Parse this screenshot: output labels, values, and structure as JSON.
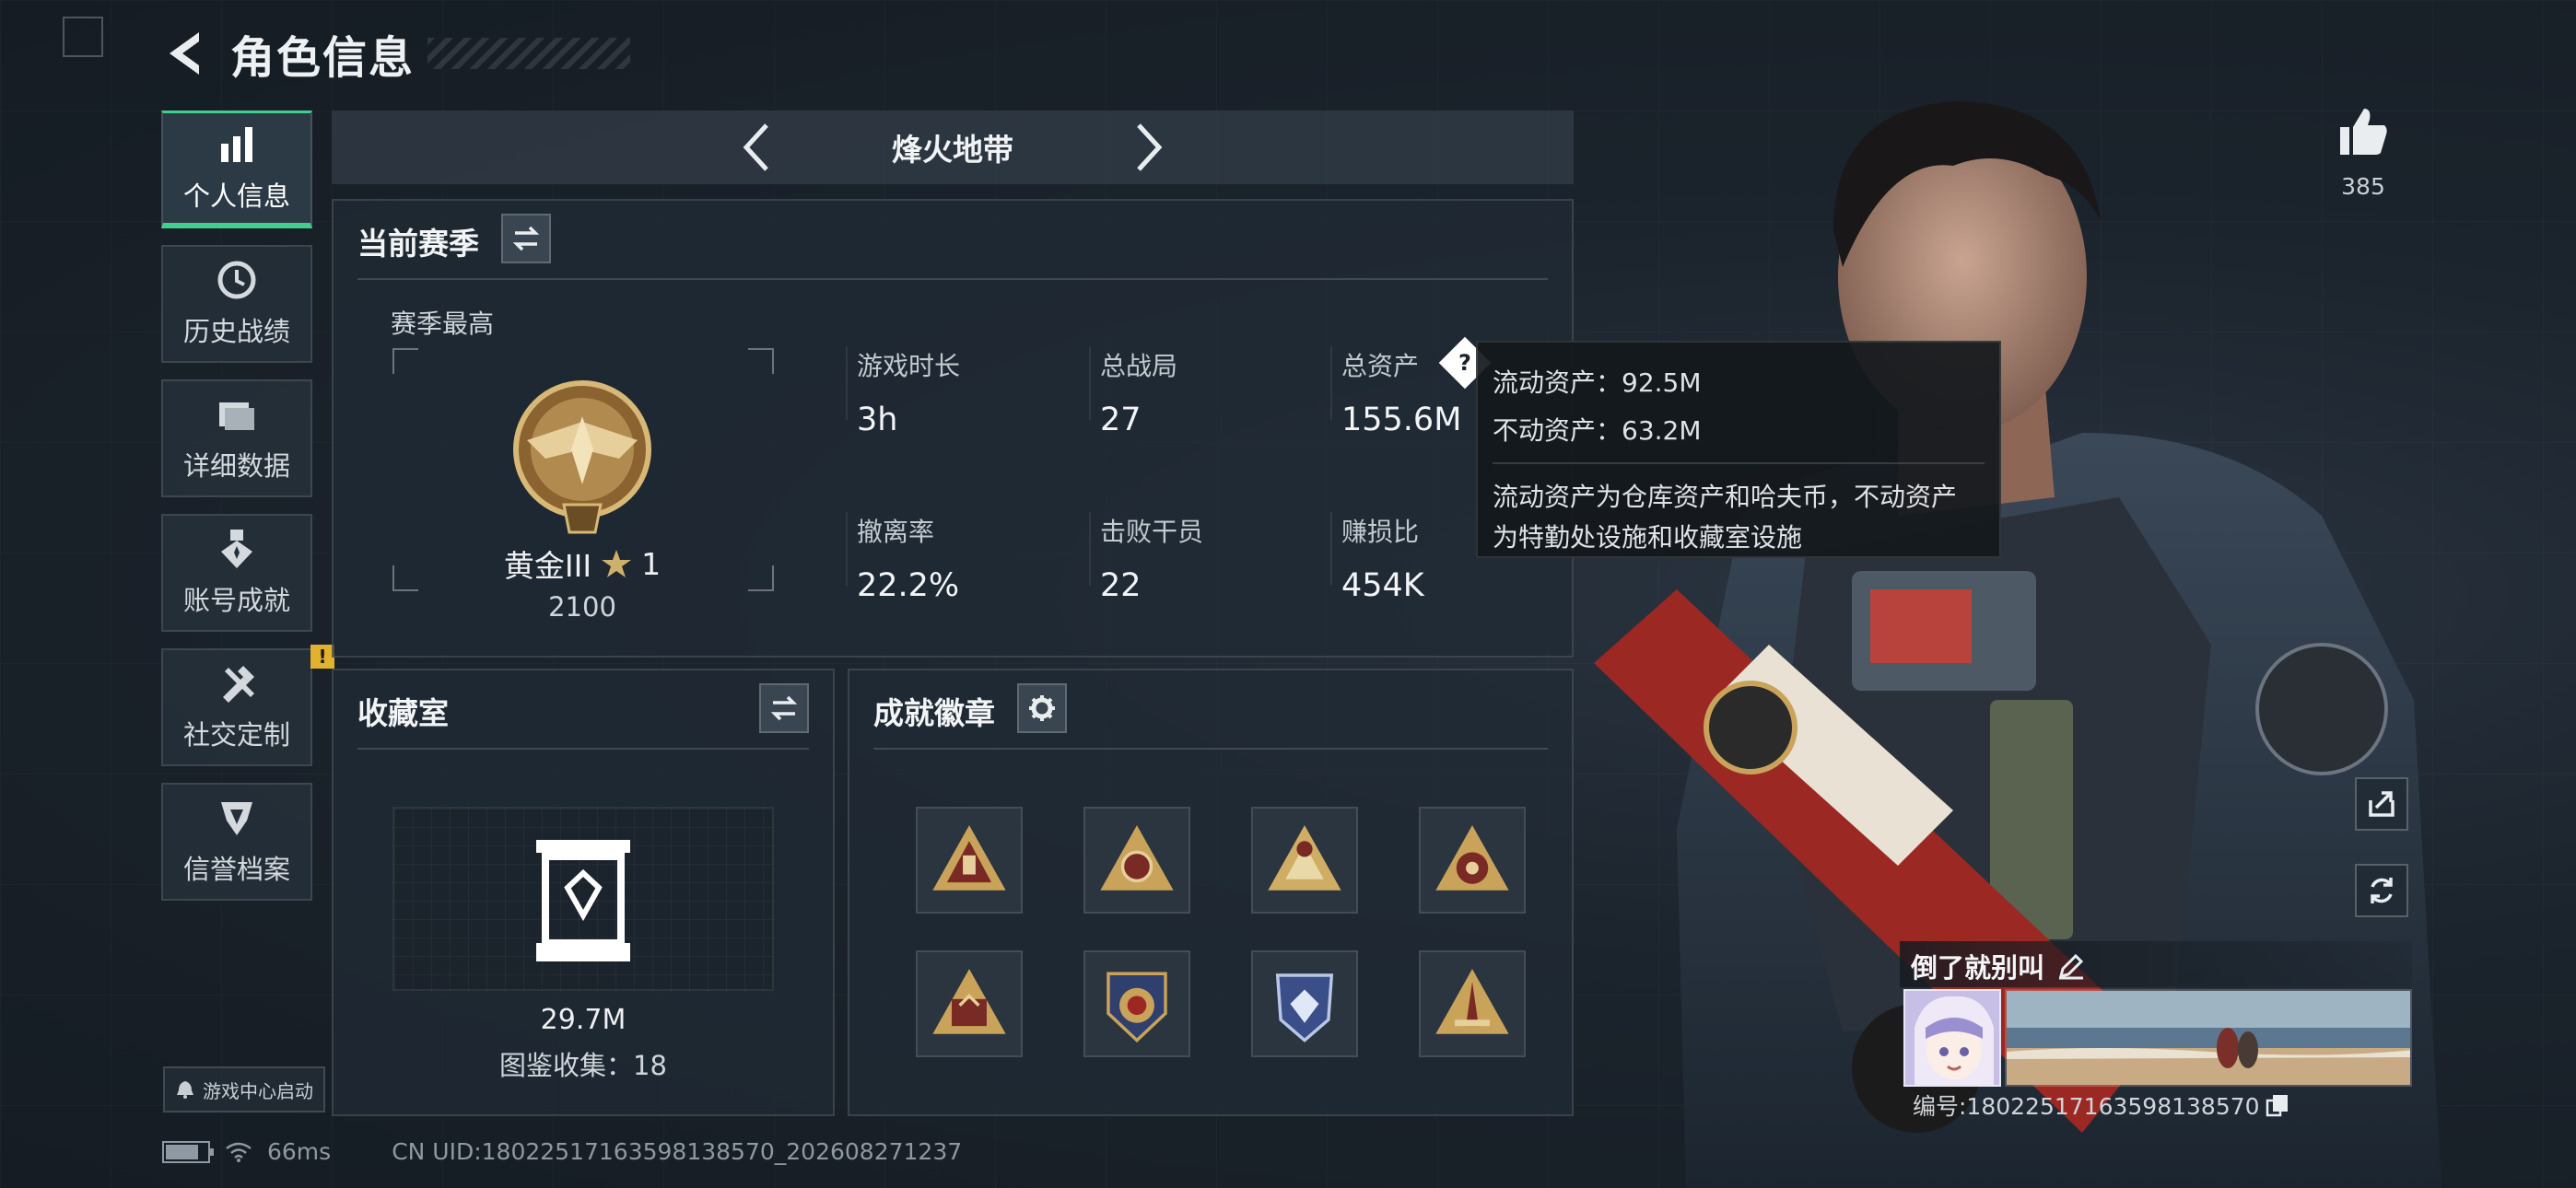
{
  "header": {
    "title": "角色信息"
  },
  "nav": {
    "items": [
      {
        "label": "个人信息",
        "icon": "bar-chart-icon",
        "active": true
      },
      {
        "label": "历史战绩",
        "icon": "history-clock-icon"
      },
      {
        "label": "详细数据",
        "icon": "folder-icon"
      },
      {
        "label": "账号成就",
        "icon": "medal-icon"
      },
      {
        "label": "社交定制",
        "icon": "tools-icon",
        "badge": "!"
      },
      {
        "label": "信誉档案",
        "icon": "shield-credit-icon"
      }
    ],
    "game_center_label": "游戏中心启动"
  },
  "mode": {
    "label": "烽火地带"
  },
  "season_panel": {
    "title": "当前赛季",
    "season_best_label": "赛季最高",
    "rank_name": "黄金III",
    "rank_stars": "1",
    "rank_score": "2100",
    "stats": [
      {
        "label": "游戏时长",
        "value": "3h"
      },
      {
        "label": "总战局",
        "value": "27"
      },
      {
        "label": "总资产",
        "value": "155.6M"
      },
      {
        "label": "撤离率",
        "value": "22.2%"
      },
      {
        "label": "击败干员",
        "value": "22"
      },
      {
        "label": "赚损比",
        "value": "454K"
      }
    ]
  },
  "tooltip": {
    "liquid": "流动资产：92.5M",
    "fixed": "不动资产：63.2M",
    "note_line1": "流动资产为仓库资产和哈夫币，不动资产",
    "note_line2": "为特勤处设施和收藏室设施"
  },
  "collection_panel": {
    "title": "收藏室",
    "value": "29.7M",
    "count": "图鉴收集：18"
  },
  "badge_panel": {
    "title": "成就徽章",
    "badges": [
      "badge-1",
      "badge-2",
      "badge-3",
      "badge-4",
      "badge-5",
      "badge-6",
      "badge-7",
      "badge-8"
    ]
  },
  "right": {
    "like_count": "385",
    "player_name": "倒了就别叫",
    "player_id": "编号:180225171635981385​70"
  },
  "status": {
    "ping": "66ms",
    "uid": "CN UID:1802251716359813857​0_202608271237"
  },
  "colors": {
    "accent": "#3fd08f",
    "warn": "#e2b22e",
    "gold": "#c9a35a"
  }
}
